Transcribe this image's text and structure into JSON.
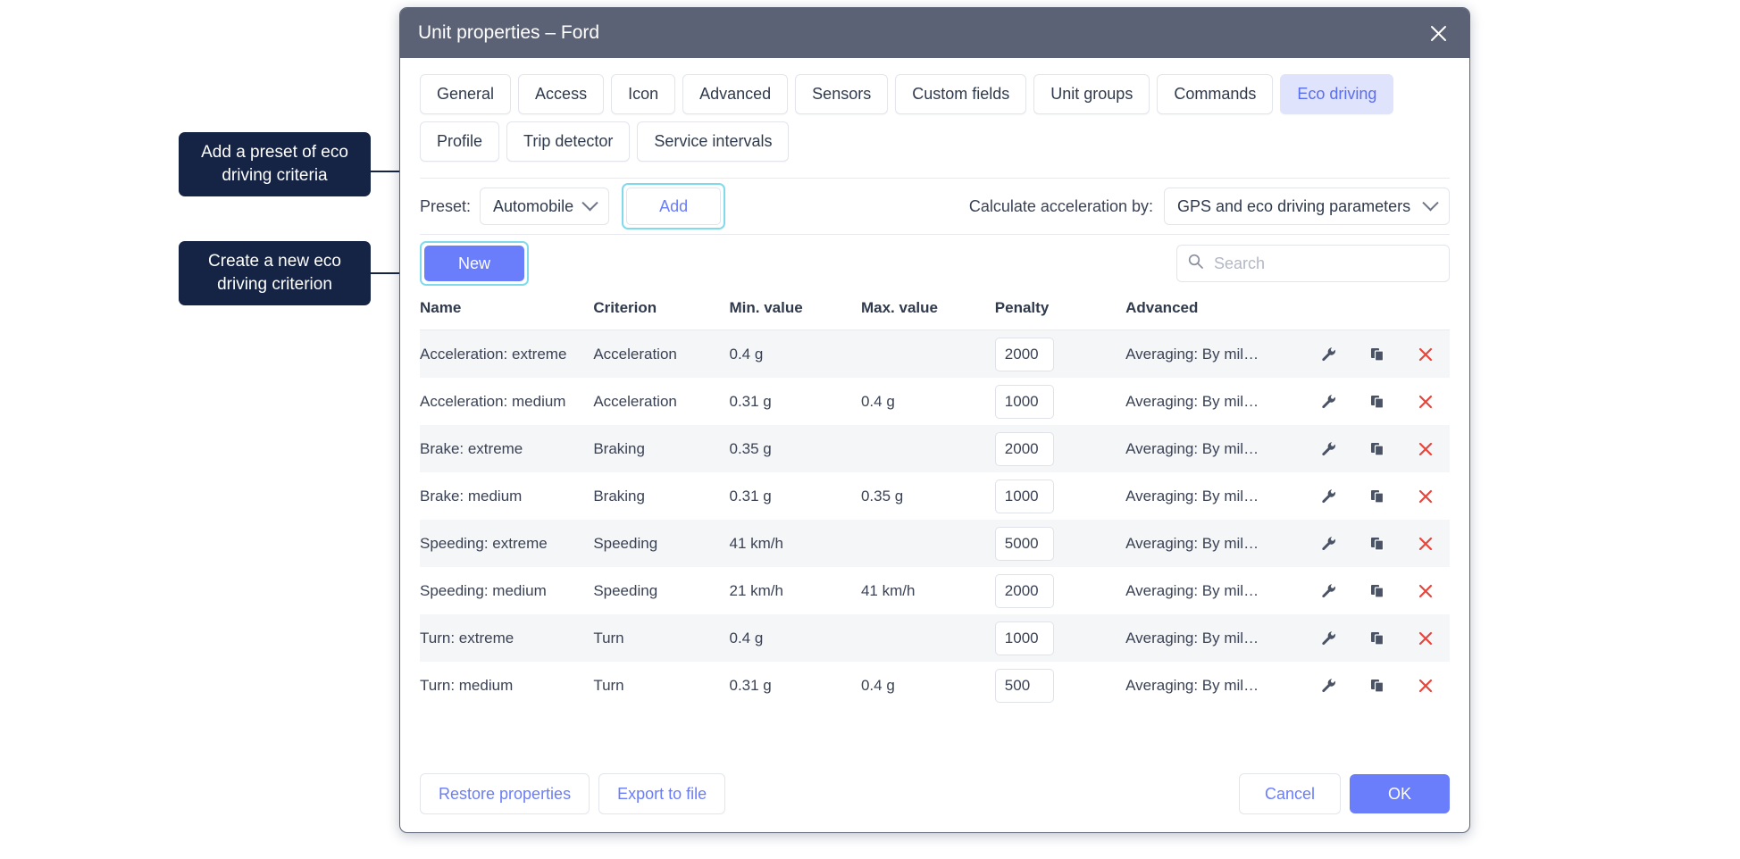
{
  "dialog": {
    "title": "Unit properties – Ford",
    "close_icon": "close-icon"
  },
  "tabs": {
    "row1": [
      {
        "label": "General",
        "active": false
      },
      {
        "label": "Access",
        "active": false
      },
      {
        "label": "Icon",
        "active": false
      },
      {
        "label": "Advanced",
        "active": false
      },
      {
        "label": "Sensors",
        "active": false
      },
      {
        "label": "Custom fields",
        "active": false
      },
      {
        "label": "Unit groups",
        "active": false
      },
      {
        "label": "Commands",
        "active": false
      },
      {
        "label": "Eco driving",
        "active": true
      }
    ],
    "row2": [
      {
        "label": "Profile",
        "active": false
      },
      {
        "label": "Trip detector",
        "active": false
      },
      {
        "label": "Service intervals",
        "active": false
      }
    ]
  },
  "preset_bar": {
    "label": "Preset:",
    "selected": "Automobile",
    "dropdown_icon": "chevron-down-icon",
    "add_label": "Add",
    "calc_label": "Calculate acceleration by:",
    "calc_selected": "GPS and eco driving parameters"
  },
  "action_bar": {
    "new_label": "New",
    "search_placeholder": "Search",
    "search_value": "",
    "search_icon": "search-icon"
  },
  "table": {
    "columns": [
      "Name",
      "Criterion",
      "Min. value",
      "Max. value",
      "Penalty",
      "Advanced"
    ],
    "rows": [
      {
        "name": "Acceleration: extreme",
        "criterion": "Acceleration",
        "min": "0.4 g",
        "max": "",
        "penalty": "2000",
        "advanced": "Averaging: By mil…"
      },
      {
        "name": "Acceleration: medium",
        "criterion": "Acceleration",
        "min": "0.31 g",
        "max": "0.4 g",
        "penalty": "1000",
        "advanced": "Averaging: By mil…"
      },
      {
        "name": "Brake: extreme",
        "criterion": "Braking",
        "min": "0.35 g",
        "max": "",
        "penalty": "2000",
        "advanced": "Averaging: By mil…"
      },
      {
        "name": "Brake: medium",
        "criterion": "Braking",
        "min": "0.31 g",
        "max": "0.35 g",
        "penalty": "1000",
        "advanced": "Averaging: By mil…"
      },
      {
        "name": "Speeding: extreme",
        "criterion": "Speeding",
        "min": "41 km/h",
        "max": "",
        "penalty": "5000",
        "advanced": "Averaging: By mil…"
      },
      {
        "name": "Speeding: medium",
        "criterion": "Speeding",
        "min": "21 km/h",
        "max": "41 km/h",
        "penalty": "2000",
        "advanced": "Averaging: By mil…"
      },
      {
        "name": "Turn: extreme",
        "criterion": "Turn",
        "min": "0.4 g",
        "max": "",
        "penalty": "1000",
        "advanced": "Averaging: By mil…"
      },
      {
        "name": "Turn: medium",
        "criterion": "Turn",
        "min": "0.31 g",
        "max": "0.4 g",
        "penalty": "500",
        "advanced": "Averaging: By mil…"
      }
    ],
    "row_icons": [
      "wrench-icon",
      "copy-icon",
      "delete-icon"
    ]
  },
  "footer": {
    "restore_label": "Restore properties",
    "export_label": "Export to file",
    "cancel_label": "Cancel",
    "ok_label": "OK"
  },
  "callouts": [
    {
      "text": "Add a preset of eco driving criteria"
    },
    {
      "text": "Create a new eco driving criterion"
    }
  ],
  "colors": {
    "header_bg": "#5b6276",
    "accent": "#6a7dfa",
    "active_tab_bg": "#dfe3fb",
    "highlight_ring": "#7fdbeb",
    "callout_bg": "#152445",
    "delete_red": "#e8453c",
    "row_stripe": "#f5f6f8"
  }
}
